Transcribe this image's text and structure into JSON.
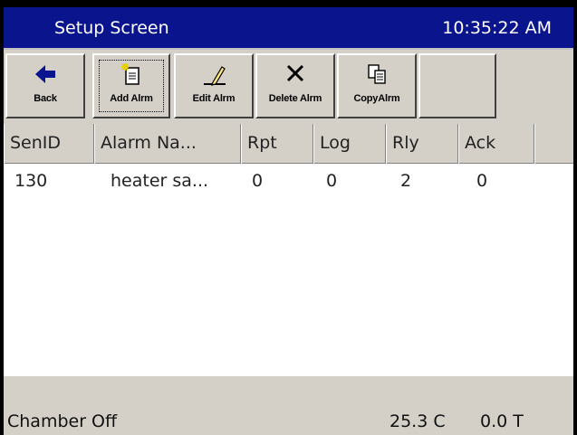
{
  "title": "Setup Screen",
  "time": "10:35:22 AM",
  "toolbar": {
    "back": "Back",
    "add": "Add Alrm",
    "edit": "Edit Alrm",
    "delete": "Delete Alrm",
    "copy": "CopyAlrm"
  },
  "table": {
    "headers": [
      "SenID",
      "Alarm Na...",
      "Rpt",
      "Log",
      "Rly",
      "Ack"
    ],
    "rows": [
      [
        "130",
        "heater sa...",
        "0",
        "0",
        "2",
        "0"
      ]
    ]
  },
  "status": {
    "chamber": "Chamber Off",
    "temp": "25.3 C",
    "t": "0.0 T"
  },
  "colors": {
    "titlebar": "#0a148c",
    "panel": "#d4d0c8"
  }
}
